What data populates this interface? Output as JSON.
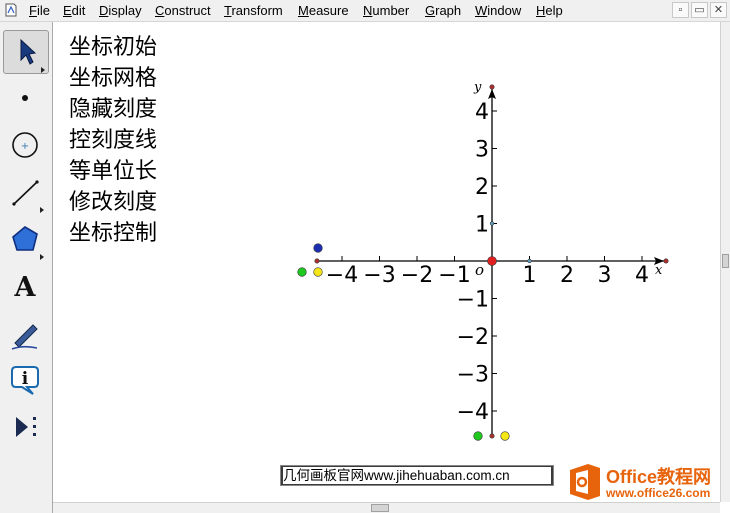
{
  "menu": {
    "items": [
      {
        "id": "file",
        "label": "File"
      },
      {
        "id": "edit",
        "label": "Edit"
      },
      {
        "id": "display",
        "label": "Display"
      },
      {
        "id": "construct",
        "label": "Construct"
      },
      {
        "id": "transform",
        "label": "Transform"
      },
      {
        "id": "measure",
        "label": "Measure"
      },
      {
        "id": "number",
        "label": "Number"
      },
      {
        "id": "graph",
        "label": "Graph"
      },
      {
        "id": "window",
        "label": "Window"
      },
      {
        "id": "help",
        "label": "Help"
      }
    ],
    "window_buttons": {
      "minimize": "▫",
      "restore": "▭",
      "close": "✕"
    }
  },
  "toolbox": {
    "tools": [
      {
        "id": "arrow",
        "icon": "arrow-select-icon",
        "selected": true
      },
      {
        "id": "point",
        "icon": "point-tool-icon"
      },
      {
        "id": "compass",
        "icon": "compass-tool-icon"
      },
      {
        "id": "straightedge",
        "icon": "straightedge-tool-icon"
      },
      {
        "id": "polygon",
        "icon": "polygon-tool-icon"
      },
      {
        "id": "text",
        "icon": "text-tool-icon",
        "glyph": "A"
      },
      {
        "id": "marker",
        "icon": "marker-tool-icon"
      },
      {
        "id": "information",
        "icon": "information-tool-icon",
        "glyph": "i"
      },
      {
        "id": "custom",
        "icon": "custom-tool-icon"
      }
    ]
  },
  "captions": [
    "坐标初始",
    "坐标网格",
    "隐藏刻度",
    "控刻度线",
    "等单位长",
    "修改刻度",
    "坐标控制"
  ],
  "graph": {
    "x_axis_label": "x",
    "y_axis_label": "y",
    "origin_label": "o",
    "x_ticks": [
      {
        "value": -4,
        "label": "−4"
      },
      {
        "value": -3,
        "label": "−3"
      },
      {
        "value": -2,
        "label": "−2"
      },
      {
        "value": -1,
        "label": "−1"
      },
      {
        "value": 1,
        "label": "1"
      },
      {
        "value": 2,
        "label": "2"
      },
      {
        "value": 3,
        "label": "3"
      },
      {
        "value": 4,
        "label": "4"
      }
    ],
    "y_ticks": [
      {
        "value": 4,
        "label": "4"
      },
      {
        "value": 3,
        "label": "3"
      },
      {
        "value": 2,
        "label": "2"
      },
      {
        "value": 1,
        "label": "1"
      },
      {
        "value": -1,
        "label": "−1"
      },
      {
        "value": -2,
        "label": "−2"
      },
      {
        "value": -3,
        "label": "−3"
      },
      {
        "value": -4,
        "label": "−4"
      }
    ],
    "colors": {
      "axis": "#000000",
      "origin": "#e02020",
      "endpoint": "#b03030",
      "unit_point": "#60a0c0",
      "control_blue": "#1a2fb0",
      "control_green": "#1ec81e",
      "control_yellow": "#f5e615"
    }
  },
  "watermark": {
    "text": "几何画板官网www.jihehuaban.com.cn"
  },
  "logo": {
    "title": "Office教程网",
    "url": "www.office26.com"
  }
}
